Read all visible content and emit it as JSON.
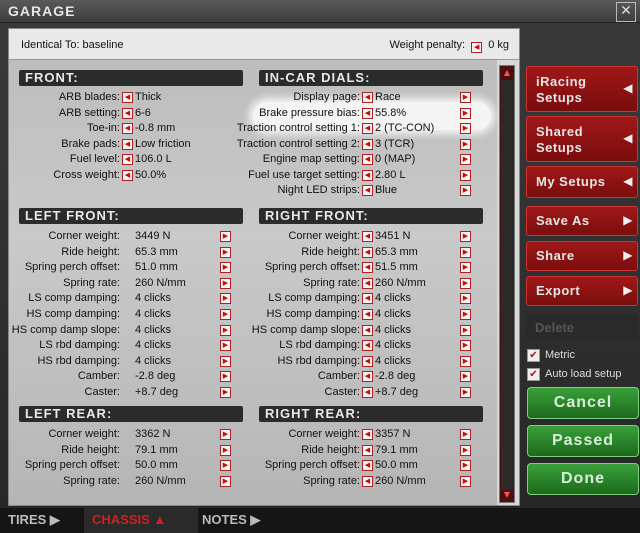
{
  "window": {
    "title": "GARAGE",
    "close_label": "✕"
  },
  "infobar": {
    "identical_to": "Identical To: baseline",
    "weight_label": "Weight penalty:",
    "weight_value": "0 kg"
  },
  "sections": {
    "front": "FRONT:",
    "incar": "IN-CAR DIALS:",
    "left_front": "LEFT FRONT:",
    "right_front": "RIGHT FRONT:",
    "left_rear": "LEFT REAR:",
    "right_rear": "RIGHT REAR:"
  },
  "front": [
    {
      "label": "ARB blades:",
      "value": "Thick"
    },
    {
      "label": "ARB setting:",
      "value": "6-6"
    },
    {
      "label": "Toe-in:",
      "value": "-0.8 mm"
    },
    {
      "label": "Brake pads:",
      "value": "Low friction"
    },
    {
      "label": "Fuel level:",
      "value": "106.0 L"
    },
    {
      "label": "Cross weight:",
      "value": "50.0%"
    }
  ],
  "incar": [
    {
      "label": "Display page:",
      "value": "Race"
    },
    {
      "label": "Brake pressure bias:",
      "value": "55.8%"
    },
    {
      "label": "Traction control setting 1:",
      "value": "2 (TC-CON)"
    },
    {
      "label": "Traction control setting 2:",
      "value": "3 (TCR)"
    },
    {
      "label": "Engine map setting:",
      "value": "0 (MAP)"
    },
    {
      "label": "Fuel use target setting:",
      "value": "2.80 L"
    },
    {
      "label": "Night LED strips:",
      "value": "Blue"
    }
  ],
  "left_front": [
    {
      "label": "Corner weight:",
      "value": "3449 N"
    },
    {
      "label": "Ride height:",
      "value": "65.3 mm"
    },
    {
      "label": "Spring perch offset:",
      "value": "51.0 mm"
    },
    {
      "label": "Spring rate:",
      "value": "260 N/mm"
    },
    {
      "label": "LS comp damping:",
      "value": "4 clicks"
    },
    {
      "label": "HS comp damping:",
      "value": "4 clicks"
    },
    {
      "label": "HS comp damp slope:",
      "value": "4 clicks"
    },
    {
      "label": "LS rbd damping:",
      "value": "4 clicks"
    },
    {
      "label": "HS rbd damping:",
      "value": "4 clicks"
    },
    {
      "label": "Camber:",
      "value": "-2.8 deg"
    },
    {
      "label": "Caster:",
      "value": "+8.7 deg"
    }
  ],
  "right_front": [
    {
      "label": "Corner weight:",
      "value": "3451 N"
    },
    {
      "label": "Ride height:",
      "value": "65.3 mm"
    },
    {
      "label": "Spring perch offset:",
      "value": "51.5 mm"
    },
    {
      "label": "Spring rate:",
      "value": "260 N/mm"
    },
    {
      "label": "LS comp damping:",
      "value": "4 clicks"
    },
    {
      "label": "HS comp damping:",
      "value": "4 clicks"
    },
    {
      "label": "HS comp damp slope:",
      "value": "4 clicks"
    },
    {
      "label": "LS rbd damping:",
      "value": "4 clicks"
    },
    {
      "label": "HS rbd damping:",
      "value": "4 clicks"
    },
    {
      "label": "Camber:",
      "value": "-2.8 deg"
    },
    {
      "label": "Caster:",
      "value": "+8.7 deg"
    }
  ],
  "left_rear": [
    {
      "label": "Corner weight:",
      "value": "3362 N"
    },
    {
      "label": "Ride height:",
      "value": "79.1 mm"
    },
    {
      "label": "Spring perch offset:",
      "value": "50.0 mm"
    },
    {
      "label": "Spring rate:",
      "value": "260 N/mm"
    }
  ],
  "right_rear": [
    {
      "label": "Corner weight:",
      "value": "3357 N"
    },
    {
      "label": "Ride height:",
      "value": "79.1 mm"
    },
    {
      "label": "Spring perch offset:",
      "value": "50.0 mm"
    },
    {
      "label": "Spring rate:",
      "value": "260 N/mm"
    }
  ],
  "sidebar": {
    "iracing_setups": [
      "iRacing",
      "Setups"
    ],
    "shared_setups": [
      "Shared",
      "Setups"
    ],
    "my_setups": "My Setups",
    "save_as": "Save As",
    "share": "Share",
    "export": "Export",
    "delete": "Delete",
    "metric": "Metric",
    "auto_load": "Auto load setup",
    "cancel": "Cancel",
    "passed": "Passed",
    "done": "Done"
  },
  "tabs": {
    "tires": "TIRES",
    "chassis": "CHASSIS",
    "notes": "NOTES"
  },
  "colors": {
    "accent_red": "#a01818",
    "green_button": "#2e8b2e"
  }
}
